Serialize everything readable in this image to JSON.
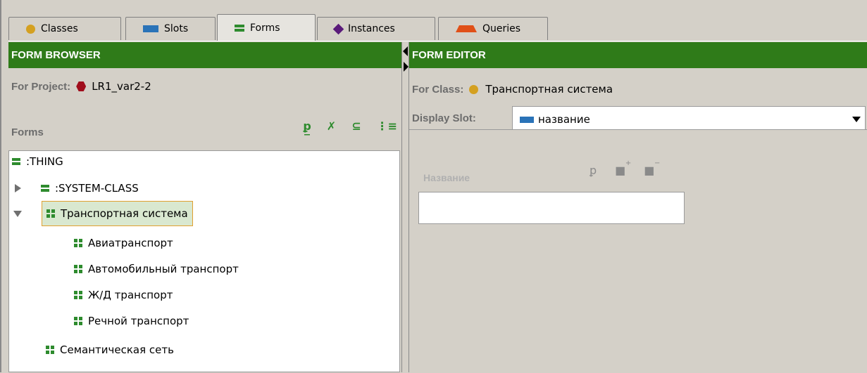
{
  "tabs": [
    {
      "label": "Classes",
      "icon": "class-circle-icon",
      "selected": false
    },
    {
      "label": "Slots",
      "icon": "slot-bar-icon",
      "selected": false
    },
    {
      "label": "Forms",
      "icon": "form-icon",
      "selected": true
    },
    {
      "label": "Instances",
      "icon": "instance-diamond-icon",
      "selected": false
    },
    {
      "label": "Queries",
      "icon": "query-icon",
      "selected": false
    }
  ],
  "form_browser": {
    "title": "FORM BROWSER",
    "project_label": "For Project:",
    "project_name": "LR1_var2-2",
    "forms_label": "Forms",
    "tree": [
      {
        "label": ":THING",
        "level": 0,
        "icon": "form-icon",
        "expander": ""
      },
      {
        "label": ":SYSTEM-CLASS",
        "level": 1,
        "icon": "form-icon",
        "expander": "collapsed"
      },
      {
        "label": "Транспортная система",
        "level": 1,
        "icon": "custom-form-icon",
        "expander": "expanded",
        "selected": true
      },
      {
        "label": "Авиатранспорт",
        "level": 2,
        "icon": "custom-form-icon"
      },
      {
        "label": "Автомобильный транспорт",
        "level": 2,
        "icon": "custom-form-icon"
      },
      {
        "label": "Ж/Д транспорт",
        "level": 2,
        "icon": "custom-form-icon"
      },
      {
        "label": "Речной транспорт",
        "level": 2,
        "icon": "custom-form-icon"
      },
      {
        "label": "Семантическая сеть",
        "level": 1,
        "icon": "custom-form-icon"
      }
    ]
  },
  "form_editor": {
    "title": "FORM EDITOR",
    "class_label": "For Class:",
    "class_name": "Транспортная система",
    "display_slot_label": "Display Slot:",
    "display_slot_value": "название",
    "widget_label": "Название",
    "widget_value": ""
  },
  "colors": {
    "header_green": "#2f7b19",
    "class_yellow": "#d4a020",
    "slot_blue": "#2a73b8",
    "project_red": "#a00d1c",
    "selection_bg": "#d9e8d0",
    "selection_border": "#e0a030"
  }
}
